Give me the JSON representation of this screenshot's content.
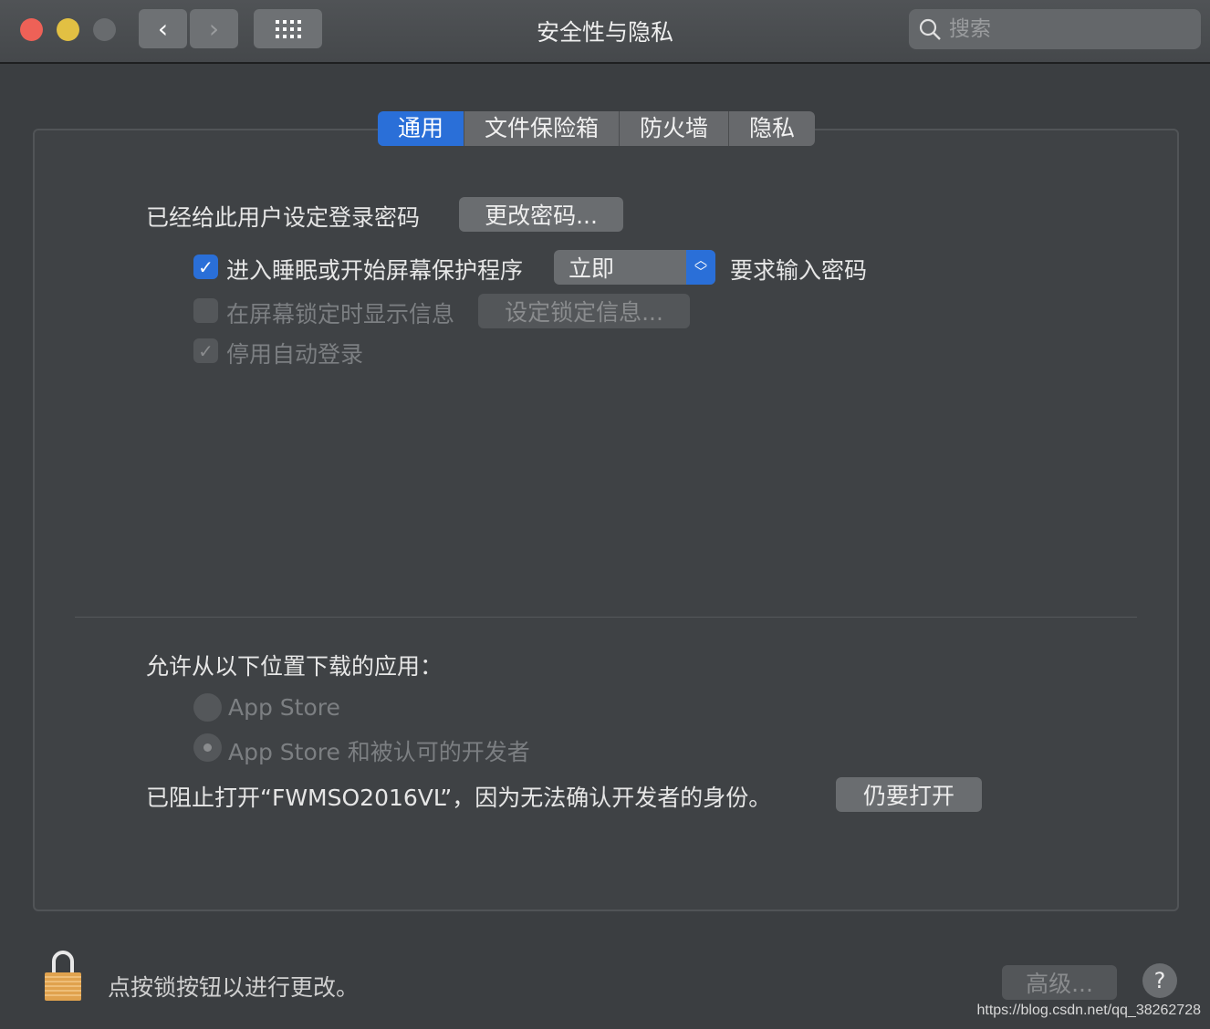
{
  "window": {
    "title": "安全性与隐私",
    "search_placeholder": "搜索"
  },
  "tabs": [
    {
      "label": "通用",
      "active": true
    },
    {
      "label": "文件保险箱"
    },
    {
      "label": "防火墙"
    },
    {
      "label": "隐私"
    }
  ],
  "general": {
    "password_set_label": "已经给此用户设定登录密码",
    "change_password_button": "更改密码...",
    "require_password": {
      "checked": true,
      "prefix": "进入睡眠或开始屏幕保护程序",
      "select_value": "立即",
      "suffix": "要求输入密码"
    },
    "show_message": {
      "checked": false,
      "label": "在屏幕锁定时显示信息",
      "button": "设定锁定信息..."
    },
    "disable_auto_login": {
      "checked": true,
      "label": "停用自动登录"
    }
  },
  "downloads": {
    "heading": "允许从以下位置下载的应用：",
    "options": [
      {
        "label": "App Store",
        "selected": false
      },
      {
        "label": "App Store 和被认可的开发者",
        "selected": true
      }
    ],
    "blocked_message": "已阻止打开“FWMSO2016VL”，因为无法确认开发者的身份。",
    "open_anyway_button": "仍要打开"
  },
  "footer": {
    "lock_message": "点按锁按钮以进行更改。",
    "advanced_button": "高级...",
    "help_button": "?"
  },
  "watermark": "https://blog.csdn.net/qq_38262728",
  "colors": {
    "accent": "#2a6fd8",
    "close": "#ee6157",
    "minimize": "#e2c043"
  }
}
